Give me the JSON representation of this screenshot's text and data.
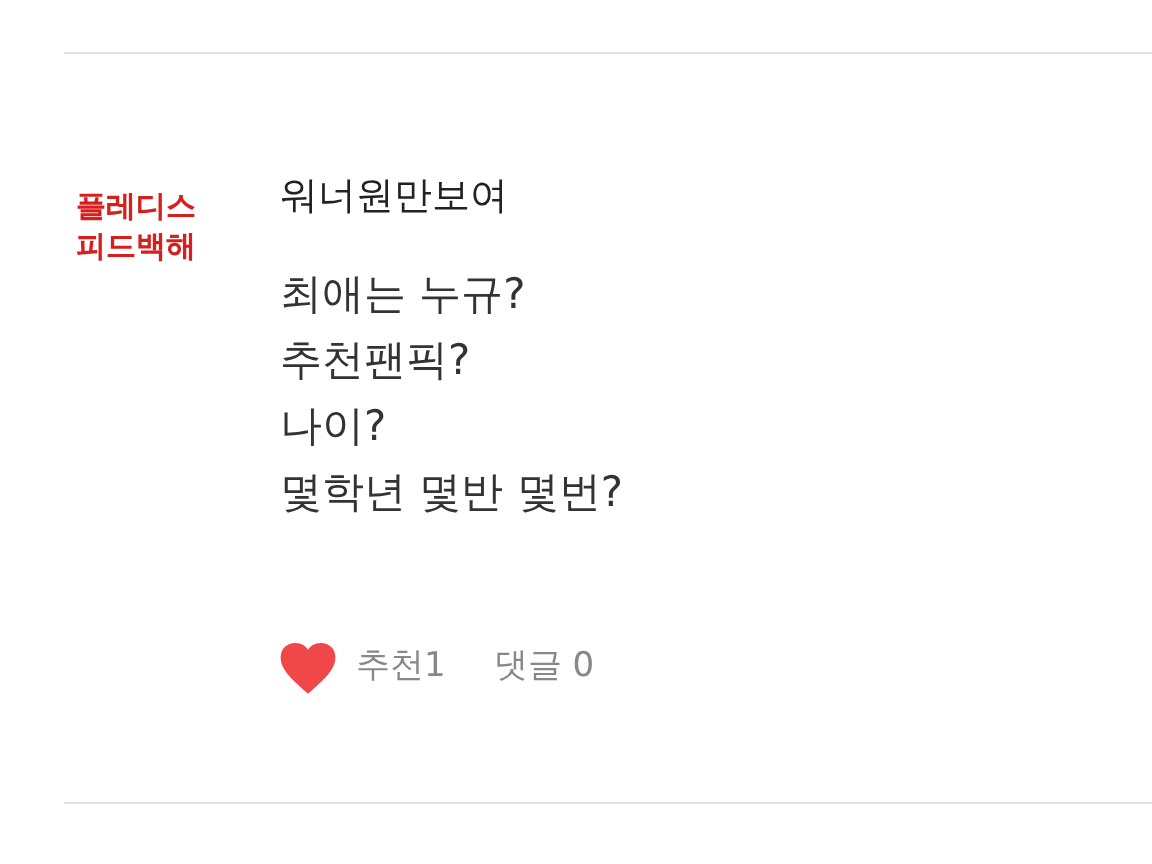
{
  "post": {
    "tag_lines": [
      "플레디스",
      "피드백해"
    ],
    "title": "워너원만보여",
    "body_lines": [
      "최애는 누규?",
      "추천팬픽?",
      "나이?",
      "몇학년 몇반 몇번?"
    ],
    "liked": true,
    "recommend": "추천1",
    "comments": "댓글 0"
  }
}
